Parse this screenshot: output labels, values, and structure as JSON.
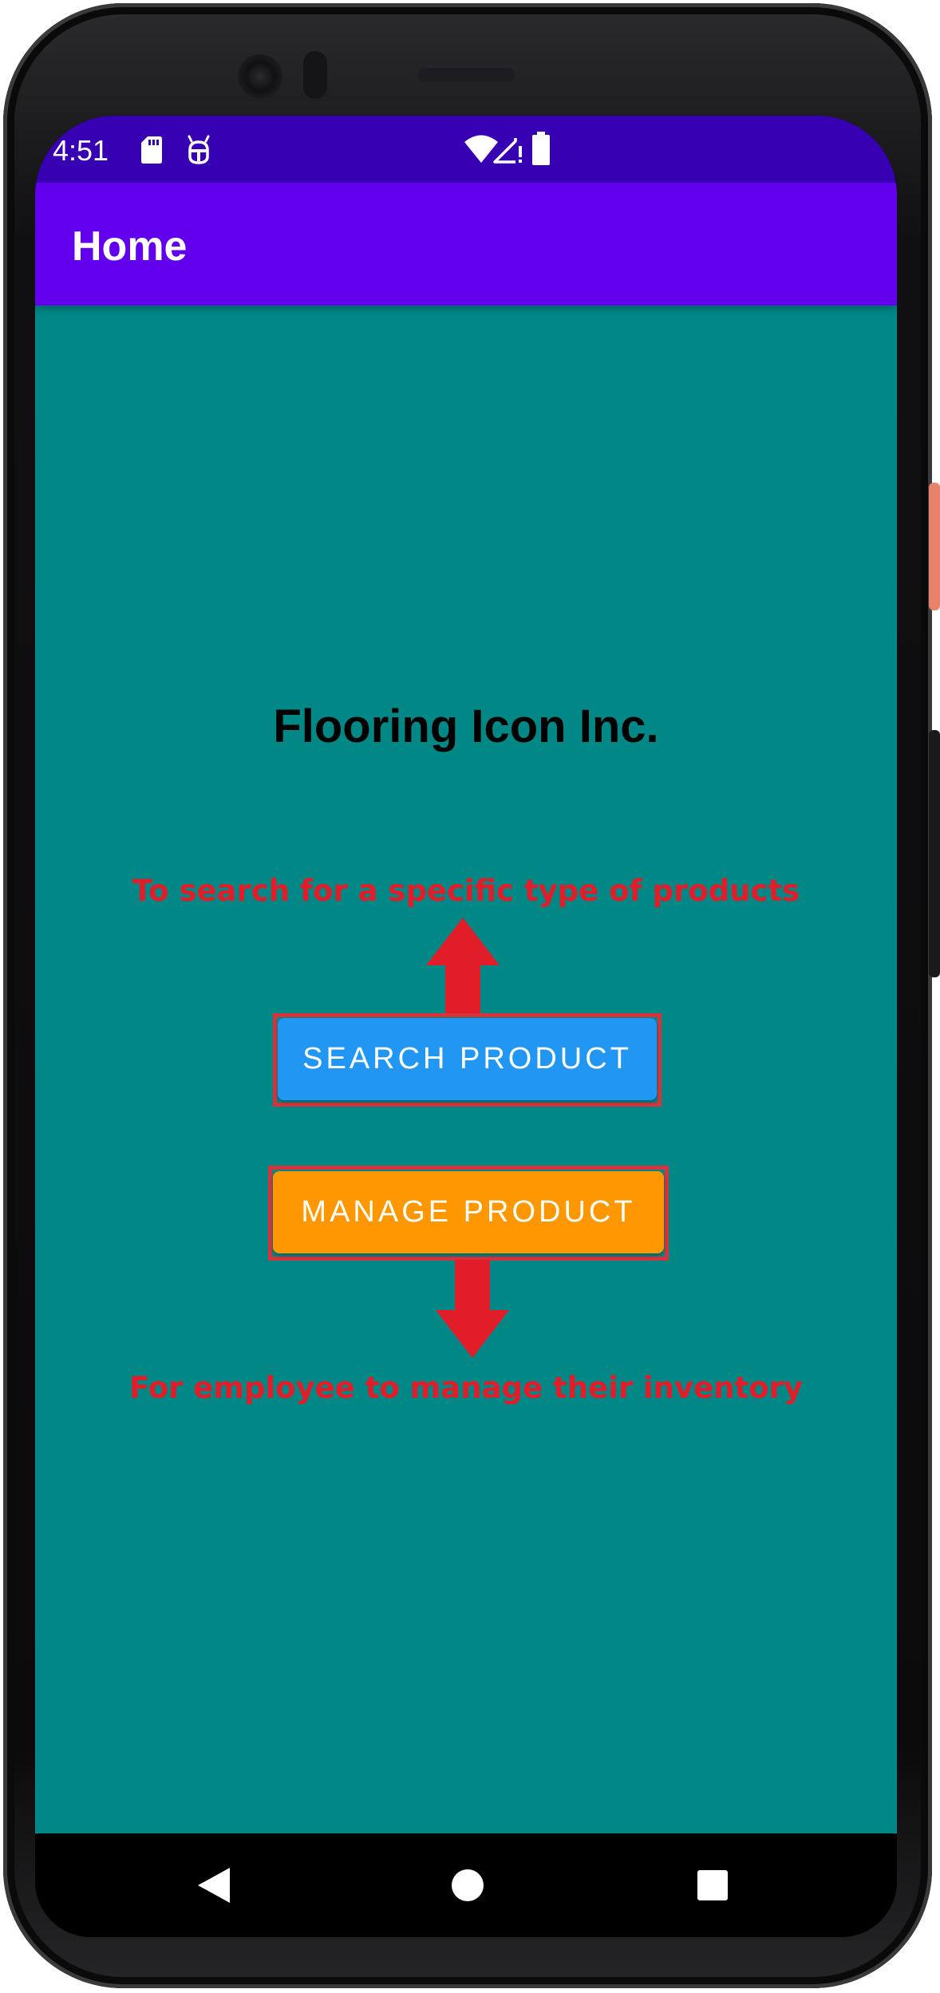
{
  "status_bar": {
    "time": "4:51",
    "left_icons": [
      "sd-card-icon",
      "debug-icon"
    ],
    "right_icons": [
      "wifi-icon",
      "cell-signal-icon",
      "battery-icon"
    ]
  },
  "app_bar": {
    "title": "Home"
  },
  "main": {
    "company_name": "Flooring Icon Inc.",
    "search_annotation": "To search for a specific type of products",
    "search_button_label": "SEARCH PRODUCT",
    "manage_button_label": "MANAGE PRODUCT",
    "manage_annotation": "For employee to manage their inventory"
  },
  "nav_bar": {
    "icons": [
      "back-icon",
      "home-icon",
      "recents-icon"
    ]
  },
  "colors": {
    "status_bar": "#3700b3",
    "app_bar": "#6200ee",
    "background": "#008786",
    "search_button": "#2196f3",
    "manage_button": "#ff9800",
    "annotation": "#e11d2a"
  }
}
